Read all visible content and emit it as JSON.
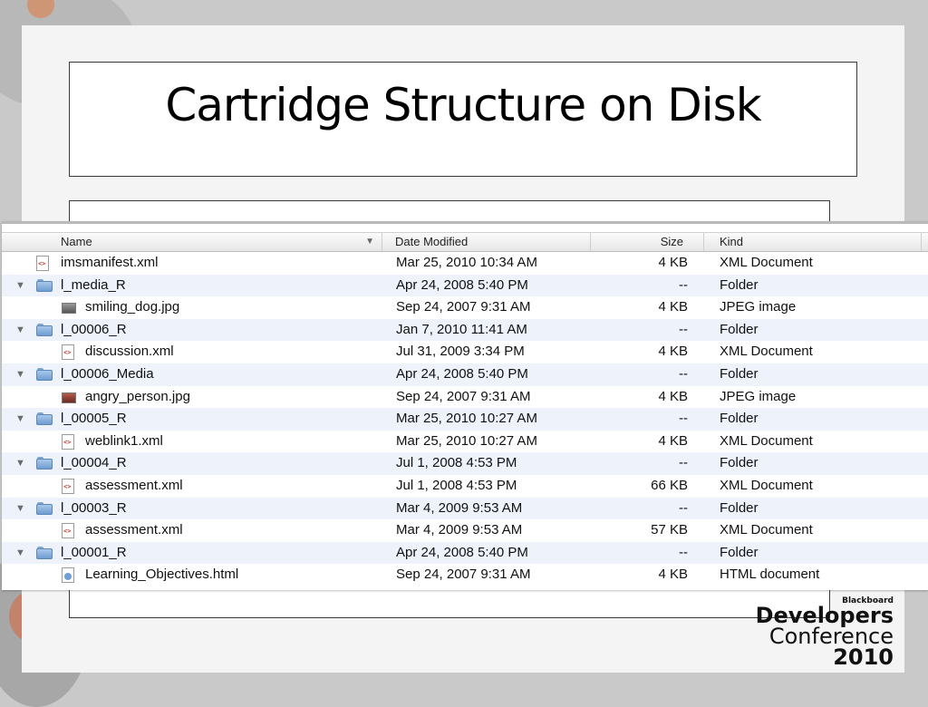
{
  "slide": {
    "title": "Cartridge Structure on Disk"
  },
  "finder": {
    "columns": {
      "name": "Name",
      "date": "Date Modified",
      "size": "Size",
      "kind": "Kind"
    },
    "rows": [
      {
        "indent": 0,
        "expandable": false,
        "icon": "xml-file-icon",
        "name": "imsmanifest.xml",
        "date": "Mar 25, 2010 10:34 AM",
        "size": "4 KB",
        "kind": "XML Document"
      },
      {
        "indent": 0,
        "expandable": true,
        "icon": "folder-icon",
        "name": "l_media_R",
        "date": "Apr 24, 2008 5:40 PM",
        "size": "--",
        "kind": "Folder"
      },
      {
        "indent": 1,
        "expandable": false,
        "icon": "image-file-icon",
        "name": "smiling_dog.jpg",
        "date": "Sep 24, 2007 9:31 AM",
        "size": "4 KB",
        "kind": "JPEG image"
      },
      {
        "indent": 0,
        "expandable": true,
        "icon": "folder-icon",
        "name": "l_00006_R",
        "date": "Jan 7, 2010 11:41 AM",
        "size": "--",
        "kind": "Folder"
      },
      {
        "indent": 1,
        "expandable": false,
        "icon": "xml-file-icon",
        "name": "discussion.xml",
        "date": "Jul 31, 2009 3:34 PM",
        "size": "4 KB",
        "kind": "XML Document"
      },
      {
        "indent": 0,
        "expandable": true,
        "icon": "folder-icon",
        "name": "l_00006_Media",
        "date": "Apr 24, 2008 5:40 PM",
        "size": "--",
        "kind": "Folder"
      },
      {
        "indent": 1,
        "expandable": false,
        "icon": "image-file-icon",
        "name": "angry_person.jpg",
        "date": "Sep 24, 2007 9:31 AM",
        "size": "4 KB",
        "kind": "JPEG image"
      },
      {
        "indent": 0,
        "expandable": true,
        "icon": "folder-icon",
        "name": "l_00005_R",
        "date": "Mar 25, 2010 10:27 AM",
        "size": "--",
        "kind": "Folder"
      },
      {
        "indent": 1,
        "expandable": false,
        "icon": "xml-file-icon",
        "name": "weblink1.xml",
        "date": "Mar 25, 2010 10:27 AM",
        "size": "4 KB",
        "kind": "XML Document"
      },
      {
        "indent": 0,
        "expandable": true,
        "icon": "folder-icon",
        "name": "l_00004_R",
        "date": "Jul 1, 2008 4:53 PM",
        "size": "--",
        "kind": "Folder"
      },
      {
        "indent": 1,
        "expandable": false,
        "icon": "xml-file-icon",
        "name": "assessment.xml",
        "date": "Jul 1, 2008 4:53 PM",
        "size": "66 KB",
        "kind": "XML Document"
      },
      {
        "indent": 0,
        "expandable": true,
        "icon": "folder-icon",
        "name": "l_00003_R",
        "date": "Mar 4, 2009 9:53 AM",
        "size": "--",
        "kind": "Folder"
      },
      {
        "indent": 1,
        "expandable": false,
        "icon": "xml-file-icon",
        "name": "assessment.xml",
        "date": "Mar 4, 2009 9:53 AM",
        "size": "57 KB",
        "kind": "XML Document"
      },
      {
        "indent": 0,
        "expandable": true,
        "icon": "folder-icon",
        "name": "l_00001_R",
        "date": "Apr 24, 2008 5:40 PM",
        "size": "--",
        "kind": "Folder"
      },
      {
        "indent": 1,
        "expandable": false,
        "icon": "html-file-icon",
        "name": "Learning_Objectives.html",
        "date": "Sep 24, 2007 9:31 AM",
        "size": "4 KB",
        "kind": "HTML document"
      }
    ]
  },
  "branding": {
    "company": "Blackboard",
    "line1": "Developers",
    "line2": "Conference",
    "line3": "2010"
  },
  "colors": {
    "alt_row": "#edf2fb",
    "folder": "#6f9dd0"
  }
}
